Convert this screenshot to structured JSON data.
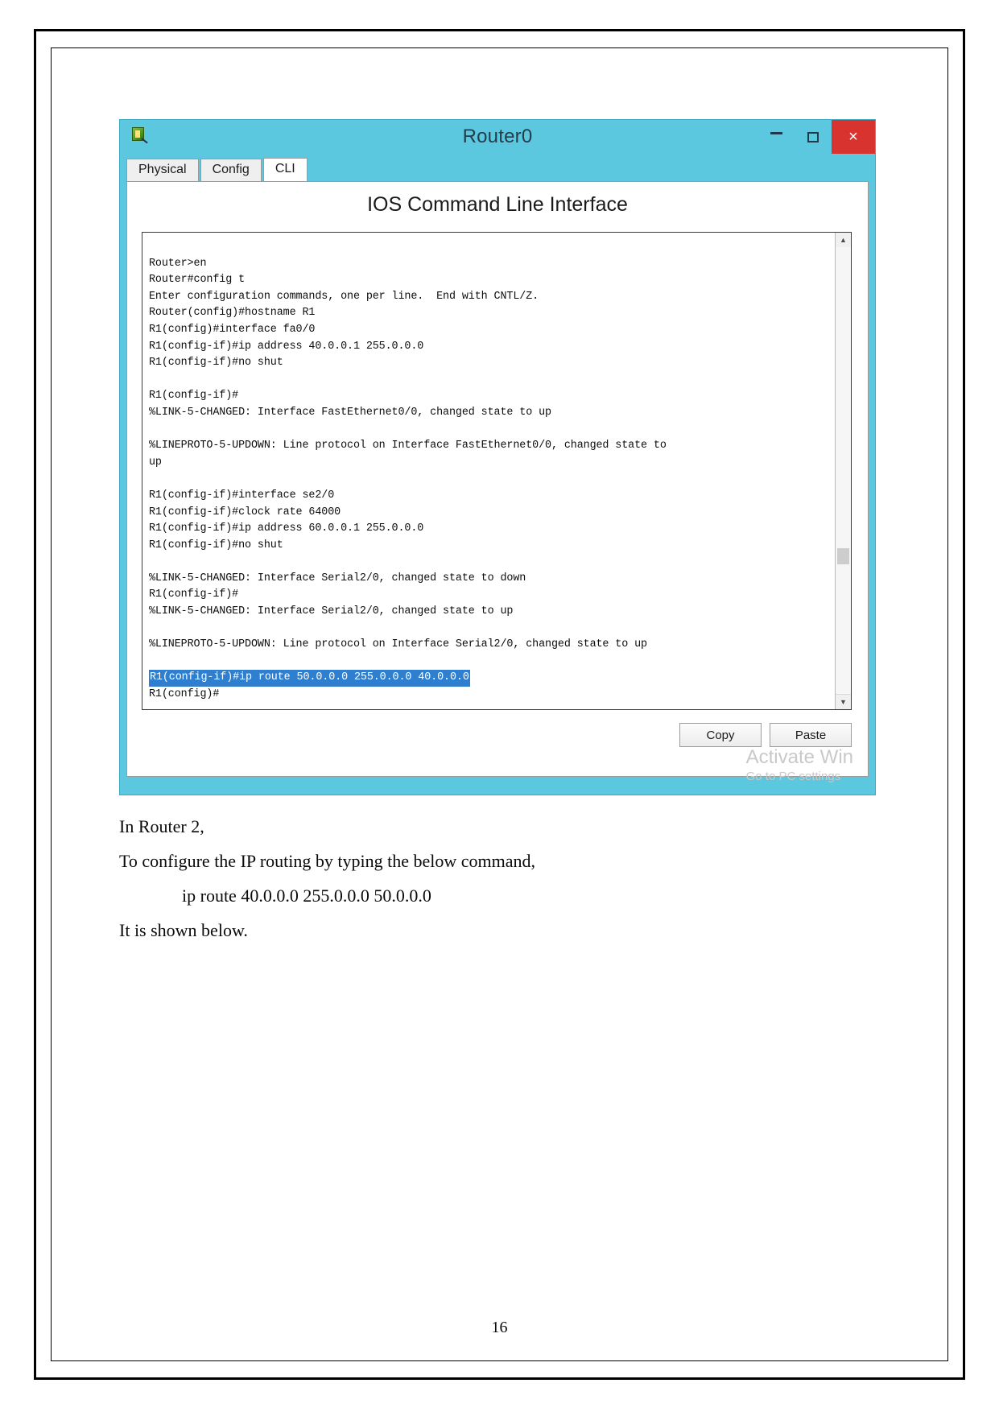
{
  "window": {
    "title": "Router0",
    "icon": "packet-tracer-icon",
    "controls": {
      "minimize": "–",
      "maximize": "▢",
      "close": "×"
    },
    "tabs": [
      {
        "label": "Physical",
        "active": false
      },
      {
        "label": "Config",
        "active": false
      },
      {
        "label": "CLI",
        "active": true
      }
    ],
    "heading": "IOS Command Line Interface",
    "buttons": {
      "copy": "Copy",
      "paste": "Paste"
    },
    "watermark": {
      "line1": "Activate Win",
      "line2": "Go to PC settings"
    }
  },
  "terminal": {
    "lines": [
      {
        "text": "",
        "selected": false
      },
      {
        "text": "Router>en",
        "selected": false
      },
      {
        "text": "Router#config t",
        "selected": false
      },
      {
        "text": "Enter configuration commands, one per line.  End with CNTL/Z.",
        "selected": false
      },
      {
        "text": "Router(config)#hostname R1",
        "selected": false
      },
      {
        "text": "R1(config)#interface fa0/0",
        "selected": false
      },
      {
        "text": "R1(config-if)#ip address 40.0.0.1 255.0.0.0",
        "selected": false
      },
      {
        "text": "R1(config-if)#no shut",
        "selected": false
      },
      {
        "text": "",
        "selected": false
      },
      {
        "text": "R1(config-if)#",
        "selected": false
      },
      {
        "text": "%LINK-5-CHANGED: Interface FastEthernet0/0, changed state to up",
        "selected": false
      },
      {
        "text": "",
        "selected": false
      },
      {
        "text": "%LINEPROTO-5-UPDOWN: Line protocol on Interface FastEthernet0/0, changed state to",
        "selected": false
      },
      {
        "text": "up",
        "selected": false
      },
      {
        "text": "",
        "selected": false
      },
      {
        "text": "R1(config-if)#interface se2/0",
        "selected": false
      },
      {
        "text": "R1(config-if)#clock rate 64000",
        "selected": false
      },
      {
        "text": "R1(config-if)#ip address 60.0.0.1 255.0.0.0",
        "selected": false
      },
      {
        "text": "R1(config-if)#no shut",
        "selected": false
      },
      {
        "text": "",
        "selected": false
      },
      {
        "text": "%LINK-5-CHANGED: Interface Serial2/0, changed state to down",
        "selected": false
      },
      {
        "text": "R1(config-if)#",
        "selected": false
      },
      {
        "text": "%LINK-5-CHANGED: Interface Serial2/0, changed state to up",
        "selected": false
      },
      {
        "text": "",
        "selected": false
      },
      {
        "text": "%LINEPROTO-5-UPDOWN: Line protocol on Interface Serial2/0, changed state to up",
        "selected": false
      },
      {
        "text": "",
        "selected": false
      },
      {
        "text": "R1(config-if)#ip route 50.0.0.0 255.0.0.0 40.0.0.0",
        "selected": true
      },
      {
        "text": "R1(config)#",
        "selected": false
      }
    ]
  },
  "document": {
    "paragraphs": [
      {
        "text": "In Router 2,",
        "indent": false
      },
      {
        "text": "To configure the IP routing by typing the below command,",
        "indent": false
      },
      {
        "text": "ip route 40.0.0.0 255.0.0.0 50.0.0.0",
        "indent": true
      },
      {
        "text": "It is shown below.",
        "indent": false
      }
    ],
    "page_number": "16"
  },
  "colors": {
    "titlebar": "#5bc8e0",
    "close_button": "#d9332f",
    "selection": "#2f7fd1"
  }
}
